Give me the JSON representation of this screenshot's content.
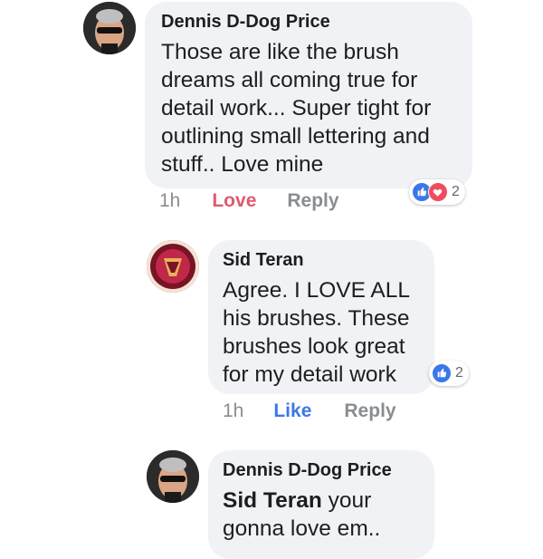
{
  "comments": [
    {
      "author": "Dennis D-Dog Price",
      "lines": [
        "Those are like the brush",
        "dreams all coming true for",
        "detail work... Super tight for",
        "outlining small lettering and",
        "stuff.. Love mine"
      ],
      "time": "1h",
      "reaction_label": "Love",
      "reply_label": "Reply",
      "reaction_count": "2",
      "reaction_icons": [
        "like-icon",
        "love-icon"
      ]
    },
    {
      "author": "Sid Teran",
      "lines": [
        "Agree. I LOVE ALL",
        "his brushes. These",
        "brushes look great",
        "for my detail work"
      ],
      "time": "1h",
      "reaction_label": "Like",
      "reply_label": "Reply",
      "reaction_count": "2",
      "reaction_icons": [
        "like-icon"
      ]
    },
    {
      "author": "Dennis D-Dog Price",
      "mention": "Sid Teran",
      "mention_rest": " your",
      "lines": [
        "gonna love em.."
      ]
    }
  ],
  "colors": {
    "bubble": "#f0f2f5",
    "love": "#e05a6d",
    "like": "#3b78e7",
    "muted": "#8a8d91"
  }
}
